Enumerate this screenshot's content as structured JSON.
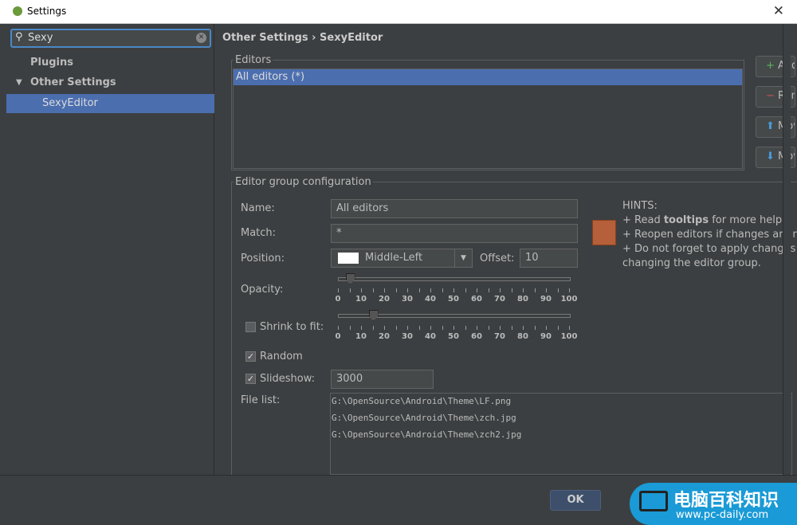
{
  "window": {
    "title": "Settings",
    "close": "✕"
  },
  "search": {
    "value": "Sexy",
    "icon": "search-icon",
    "clear_icon": "clear-icon"
  },
  "tree": {
    "items": [
      {
        "label": "Plugins"
      },
      {
        "label": "Other Settings",
        "expanded": true
      },
      {
        "label": "SexyEditor",
        "selected": true
      }
    ]
  },
  "breadcrumb": "Other Settings › SexyEditor",
  "editors": {
    "legend": "Editors",
    "items": [
      "All editors (*)"
    ],
    "buttons": [
      {
        "icon": "+",
        "label": "Add"
      },
      {
        "icon": "−",
        "label": "Remove"
      },
      {
        "icon": "⬆",
        "label": "Move Up"
      },
      {
        "icon": "⬇",
        "label": "Move Down"
      }
    ]
  },
  "config": {
    "legend": "Editor group configuration",
    "name_label": "Name:",
    "name_value": "All editors",
    "match_label": "Match:",
    "match_value": "*",
    "position_label": "Position:",
    "position_value": "Middle-Left",
    "offset_label": "Offset:",
    "offset_value": "10",
    "opacity_label": "Opacity:",
    "opacity_value": 5,
    "shrink_label": "Shrink to fit:",
    "shrink_checked": false,
    "shrink_value": 15,
    "ticks": [
      "0",
      "10",
      "20",
      "30",
      "40",
      "50",
      "60",
      "70",
      "80",
      "90",
      "100"
    ],
    "random_label": "Random",
    "random_checked": true,
    "slideshow_label": "Slideshow:",
    "slideshow_checked": true,
    "slideshow_value": "3000",
    "filelist_label": "File list:",
    "files": [
      "G:\\OpenSource\\Android\\Theme\\LF.png",
      "G:\\OpenSource\\Android\\Theme\\zch.jpg",
      "G:\\OpenSource\\Android\\Theme\\zch2.jpg"
    ]
  },
  "hints": {
    "title": "HINTS:",
    "l1a": "+ Read ",
    "l1b": "tooltips",
    "l1c": " for more help.",
    "l2": "+ Reopen editors if changes are not",
    "l3": "+ Do not forget to apply changes",
    "l4": "changing the editor group."
  },
  "footer": {
    "ok": "OK"
  },
  "watermark": {
    "cn": "电脑百科知识",
    "url": "www.pc-daily.com",
    "color": "#1a9ad6"
  }
}
